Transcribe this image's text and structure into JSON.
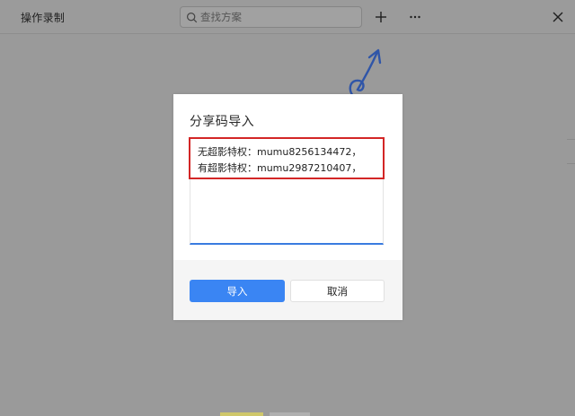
{
  "window": {
    "title": "操作录制",
    "search_placeholder": "查找方案",
    "add_icon": "plus-icon",
    "more_icon": "ellipsis-icon",
    "close_icon": "close-icon"
  },
  "dialog": {
    "title": "分享码导入",
    "code_lines": [
      "无超影特权：mumu8256134472，",
      "有超影特权：mumu2987210407，"
    ],
    "confirm_label": "导入",
    "cancel_label": "取消"
  },
  "colors": {
    "accent": "#3a85f3",
    "highlight": "#d32626",
    "overlay": "#9a9a9a"
  }
}
